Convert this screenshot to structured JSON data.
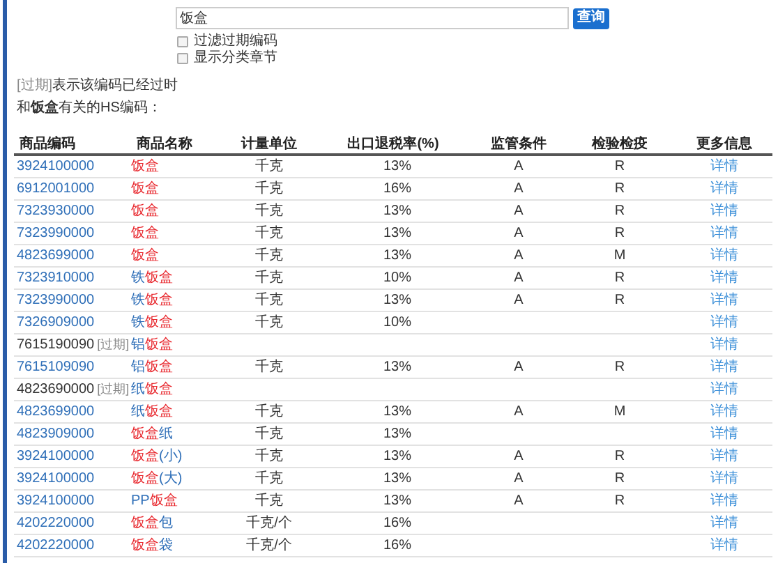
{
  "search": {
    "value": "饭盒",
    "button": "查询"
  },
  "options": [
    {
      "label": "过滤过期编码",
      "checked": false
    },
    {
      "label": "显示分类章节",
      "checked": false
    }
  ],
  "notice": {
    "tag": "[过期]",
    "text": "表示该编码已经过时"
  },
  "heading": "和**饭盒**有关的HS编码：",
  "table": {
    "columns": [
      "商品编码",
      "商品名称",
      "计量单位",
      "出口退税率(%)",
      "监管条件",
      "检验检疫",
      "更多信息"
    ],
    "rows": [
      {
        "code": "3924100000",
        "expired": false,
        "name": [
          {
            "text": "饭盒",
            "match": true
          }
        ],
        "unit": "千克",
        "rate": "13%",
        "supervision": "A",
        "inspection": "R",
        "more": "详情"
      },
      {
        "code": "6912001000",
        "expired": false,
        "name": [
          {
            "text": "饭盒",
            "match": true
          }
        ],
        "unit": "千克",
        "rate": "16%",
        "supervision": "A",
        "inspection": "R",
        "more": "详情"
      },
      {
        "code": "7323930000",
        "expired": false,
        "name": [
          {
            "text": "饭盒",
            "match": true
          }
        ],
        "unit": "千克",
        "rate": "13%",
        "supervision": "A",
        "inspection": "R",
        "more": "详情"
      },
      {
        "code": "7323990000",
        "expired": false,
        "name": [
          {
            "text": "饭盒",
            "match": true
          }
        ],
        "unit": "千克",
        "rate": "13%",
        "supervision": "A",
        "inspection": "R",
        "more": "详情"
      },
      {
        "code": "4823699000",
        "expired": false,
        "name": [
          {
            "text": "饭盒",
            "match": true
          }
        ],
        "unit": "千克",
        "rate": "13%",
        "supervision": "A",
        "inspection": "M",
        "more": "详情"
      },
      {
        "code": "7323910000",
        "expired": false,
        "name": [
          {
            "text": "铁",
            "match": false
          },
          {
            "text": "饭盒",
            "match": true
          }
        ],
        "unit": "千克",
        "rate": "10%",
        "supervision": "A",
        "inspection": "R",
        "more": "详情"
      },
      {
        "code": "7323990000",
        "expired": false,
        "name": [
          {
            "text": "铁",
            "match": false
          },
          {
            "text": "饭盒",
            "match": true
          }
        ],
        "unit": "千克",
        "rate": "13%",
        "supervision": "A",
        "inspection": "R",
        "more": "详情"
      },
      {
        "code": "7326909000",
        "expired": false,
        "name": [
          {
            "text": "铁",
            "match": false
          },
          {
            "text": "饭盒",
            "match": true
          }
        ],
        "unit": "千克",
        "rate": "10%",
        "more": "详情"
      },
      {
        "code": "7615190090",
        "expired": true,
        "expired_tag": "[过期]",
        "name": [
          {
            "text": "铝",
            "match": false
          },
          {
            "text": "饭盒",
            "match": true
          }
        ],
        "more": "详情"
      },
      {
        "code": "7615109090",
        "expired": false,
        "name": [
          {
            "text": "铝",
            "match": false
          },
          {
            "text": "饭盒",
            "match": true
          }
        ],
        "unit": "千克",
        "rate": "13%",
        "supervision": "A",
        "inspection": "R",
        "more": "详情"
      },
      {
        "code": "4823690000",
        "expired": true,
        "expired_tag": "[过期]",
        "name": [
          {
            "text": "纸",
            "match": false
          },
          {
            "text": "饭盒",
            "match": true
          }
        ],
        "more": "详情"
      },
      {
        "code": "4823699000",
        "expired": false,
        "name": [
          {
            "text": "纸",
            "match": false
          },
          {
            "text": "饭盒",
            "match": true
          }
        ],
        "unit": "千克",
        "rate": "13%",
        "supervision": "A",
        "inspection": "M",
        "more": "详情"
      },
      {
        "code": "4823909000",
        "expired": false,
        "name": [
          {
            "text": "饭盒",
            "match": true
          },
          {
            "text": "纸",
            "match": false
          }
        ],
        "unit": "千克",
        "rate": "13%",
        "more": "详情"
      },
      {
        "code": "3924100000",
        "expired": false,
        "name": [
          {
            "text": "饭盒",
            "match": true
          },
          {
            "text": "(小)",
            "match": false
          }
        ],
        "unit": "千克",
        "rate": "13%",
        "supervision": "A",
        "inspection": "R",
        "more": "详情"
      },
      {
        "code": "3924100000",
        "expired": false,
        "name": [
          {
            "text": "饭盒",
            "match": true
          },
          {
            "text": "(大)",
            "match": false
          }
        ],
        "unit": "千克",
        "rate": "13%",
        "supervision": "A",
        "inspection": "R",
        "more": "详情"
      },
      {
        "code": "3924100000",
        "expired": false,
        "name": [
          {
            "text": "PP",
            "match": false
          },
          {
            "text": "饭盒",
            "match": true
          }
        ],
        "unit": "千克",
        "rate": "13%",
        "supervision": "A",
        "inspection": "R",
        "more": "详情"
      },
      {
        "code": "4202220000",
        "expired": false,
        "name": [
          {
            "text": "饭盒",
            "match": true
          },
          {
            "text": "包",
            "match": false
          }
        ],
        "unit": "千克/个",
        "rate": "16%",
        "more": "详情"
      },
      {
        "code": "4202220000",
        "expired": false,
        "name": [
          {
            "text": "饭盒",
            "match": true
          },
          {
            "text": "袋",
            "match": false
          }
        ],
        "unit": "千克/个",
        "rate": "16%",
        "more": "详情"
      }
    ]
  }
}
